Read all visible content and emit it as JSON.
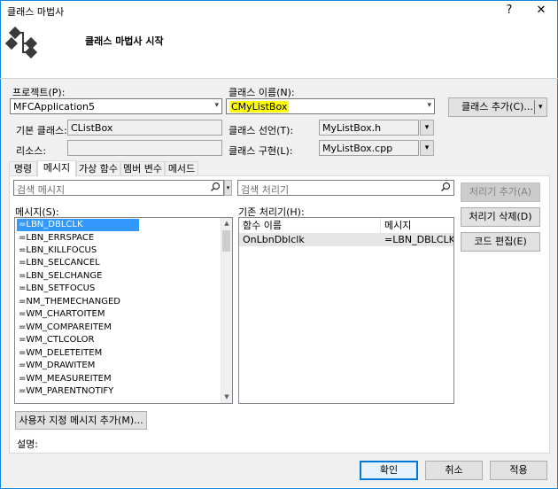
{
  "window": {
    "title": "클래스 마법사",
    "help": "?",
    "close": "✕"
  },
  "header": {
    "title": "클래스 마법사 시작"
  },
  "form": {
    "project_label": "프로젝트(P):",
    "project_value": "MFCApplication5",
    "class_name_label": "클래스 이름(N):",
    "class_name_value": "CMyListBox",
    "add_class_label": "클래스 추가(C)...",
    "base_class_label": "기본 클래스:",
    "base_class_value": "CListBox",
    "class_decl_label": "클래스 선언(T):",
    "class_decl_value": "MyListBox.h",
    "resource_label": "리소스:",
    "resource_value": "",
    "class_impl_label": "클래스 구현(L):",
    "class_impl_value": "MyListBox.cpp"
  },
  "tabs": [
    {
      "label": "명령"
    },
    {
      "label": "메시지"
    },
    {
      "label": "가상 함수"
    },
    {
      "label": "멤버 변수"
    },
    {
      "label": "메서드"
    }
  ],
  "messages_tab": {
    "search_placeholder": "검색 메시지",
    "handler_search_placeholder": "검색 처리기",
    "messages_label": "메시지(S):",
    "handlers_label": "기존 처리기(H):",
    "messages": [
      "=LBN_DBLCLK",
      "=LBN_ERRSPACE",
      "=LBN_KILLFOCUS",
      "=LBN_SELCANCEL",
      "=LBN_SELCHANGE",
      "=LBN_SETFOCUS",
      "=NM_THEMECHANGED",
      "=WM_CHARTOITEM",
      "=WM_COMPAREITEM",
      "=WM_CTLCOLOR",
      "=WM_DELETEITEM",
      "=WM_DRAWITEM",
      "=WM_MEASUREITEM",
      "=WM_PARENTNOTIFY"
    ],
    "handler_headers": {
      "func": "함수 이름",
      "msg": "메시지"
    },
    "handlers": [
      {
        "func": "OnLbnDblclk",
        "msg": "=LBN_DBLCLK"
      }
    ],
    "add_handler": "처리기 추가(A)",
    "delete_handler": "처리기 삭제(D)",
    "edit_code": "코드 편집(E)",
    "add_custom": "사용자 지정 메시지 추가(M)...",
    "description_label": "설명:"
  },
  "footer": {
    "ok": "확인",
    "cancel": "취소",
    "apply": "적용"
  },
  "colors": {
    "accent": "#1883d7",
    "highlight": "#ffff00",
    "selection": "#3399ff"
  }
}
